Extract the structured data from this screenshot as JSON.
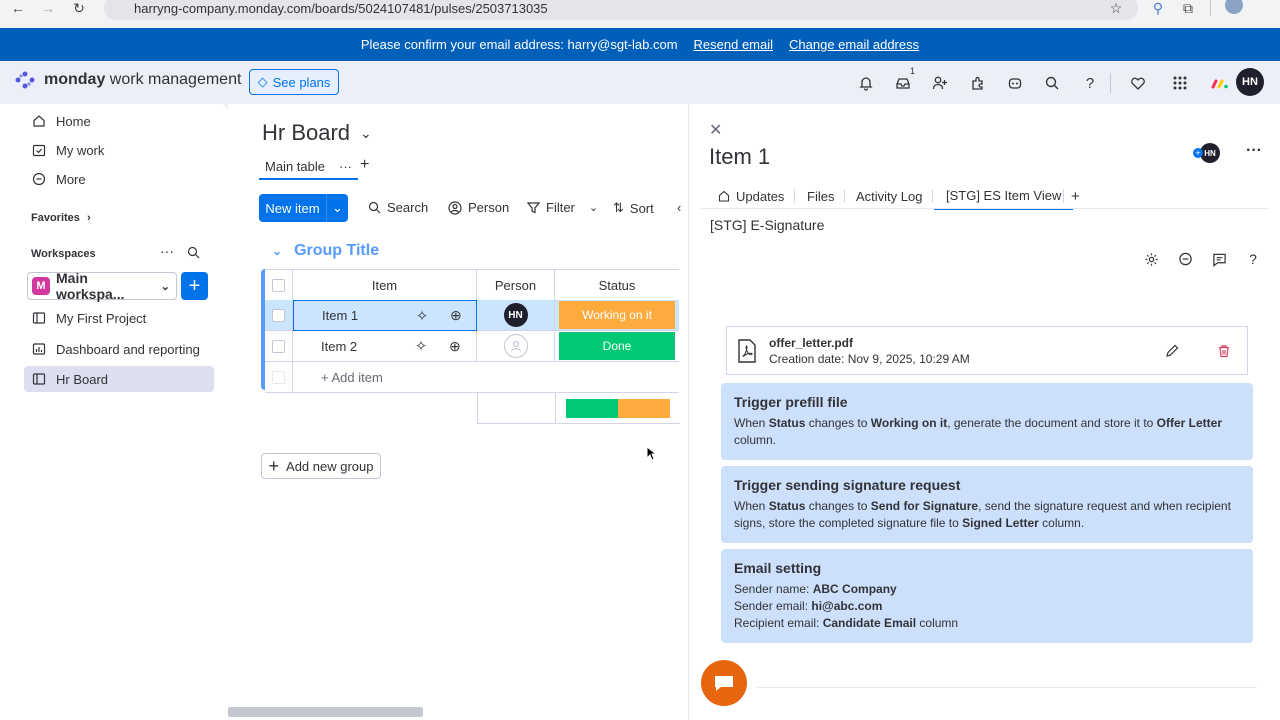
{
  "browser": {
    "url": "harryng-company.monday.com/boards/5024107481/pulses/2503713035"
  },
  "banner": {
    "text": "Please confirm your email address: harry@sgt-lab.com",
    "resend": "Resend email",
    "change": "Change email address"
  },
  "topbar": {
    "brand": "monday",
    "brand_suffix": "work management",
    "see_plans": "See plans",
    "inbox_count": "1",
    "user_initials": "HN"
  },
  "sidebar": {
    "items": [
      {
        "label": "Home"
      },
      {
        "label": "My work"
      },
      {
        "label": "More"
      }
    ],
    "favorites": "Favorites",
    "workspaces": "Workspaces",
    "workspace_name": "Main workspa...",
    "workspace_badge": "M",
    "boards": [
      {
        "label": "My First Project"
      },
      {
        "label": "Dashboard and reporting"
      },
      {
        "label": "Hr Board"
      }
    ]
  },
  "board": {
    "title": "Hr Board",
    "tab": "Main table",
    "new_item": "New item",
    "tools": {
      "search": "Search",
      "person": "Person",
      "filter": "Filter",
      "sort": "Sort"
    },
    "group_title": "Group Title",
    "columns": {
      "item": "Item",
      "person": "Person",
      "status": "Status"
    },
    "rows": [
      {
        "name": "Item 1",
        "person": "HN",
        "status": "Working on it",
        "status_color": "#fdab3d"
      },
      {
        "name": "Item 2",
        "person": "",
        "status": "Done",
        "status_color": "#00c875"
      }
    ],
    "add_item": "+ Add item",
    "add_group": "Add new group",
    "summary": [
      {
        "color": "#00c875",
        "fraction": 0.5
      },
      {
        "color": "#fdab3d",
        "fraction": 0.5
      }
    ]
  },
  "panel": {
    "title": "Item 1",
    "avatar": "HN",
    "tabs": [
      {
        "label": "Updates"
      },
      {
        "label": "Files"
      },
      {
        "label": "Activity Log"
      },
      {
        "label": "[STG] ES Item View"
      }
    ],
    "app_title": "[STG] E-Signature",
    "file": {
      "name": "offer_letter.pdf",
      "created": "Creation date: Nov 9, 2025, 10:29 AM"
    },
    "card1": {
      "title": "Trigger prefill file",
      "p1": "When ",
      "b1": "Status",
      "p2": " changes to ",
      "b2": "Working on it",
      "p3": ", generate the document and store it to ",
      "b3": "Offer Letter",
      "p4": " column."
    },
    "card2": {
      "title": "Trigger sending signature request",
      "p1": "When ",
      "b1": "Status",
      "p2": " changes to ",
      "b2": "Send for Signature",
      "p3": ", send the signature request and when recipient signs, store the completed signature file to ",
      "b3": "Signed Letter",
      "p4": " column."
    },
    "card3": {
      "title": "Email setting",
      "l1": "Sender name: ",
      "v1": "ABC Company",
      "l2": "Sender email: ",
      "v2": "hi@abc.com",
      "l3": "Recipient email: ",
      "v3": "Candidate Email",
      "s3": " column"
    }
  },
  "colors": {
    "primary": "#0073ea",
    "banner": "#0060b9",
    "info_card": "#cce0fb",
    "group": "#579bfc"
  }
}
